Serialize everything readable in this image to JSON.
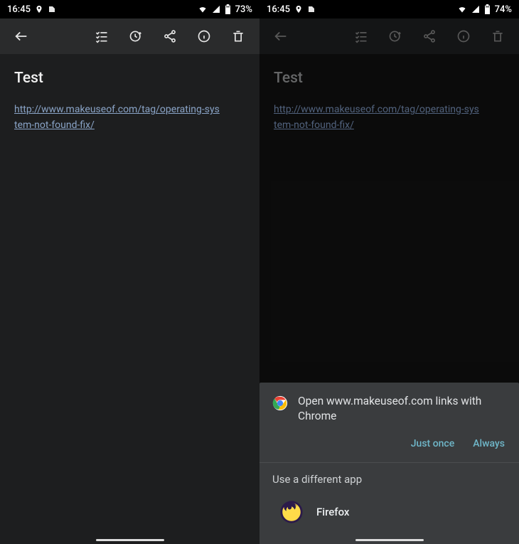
{
  "left": {
    "status": {
      "time": "16:45",
      "battery": "73%"
    },
    "note": {
      "title": "Test",
      "url": "http://www.makeuseof.com/tag/operating-system-not-found-fix/"
    }
  },
  "right": {
    "status": {
      "time": "16:45",
      "battery": "74%"
    },
    "note": {
      "title": "Test",
      "url": "http://www.makeuseof.com/tag/operating-system-not-found-fix/"
    },
    "sheet": {
      "prompt": "Open www.makeuseof.com links with Chrome",
      "just_once": "Just once",
      "always": "Always",
      "alt_header": "Use a different app",
      "apps": [
        {
          "name": "Firefox"
        }
      ]
    }
  }
}
